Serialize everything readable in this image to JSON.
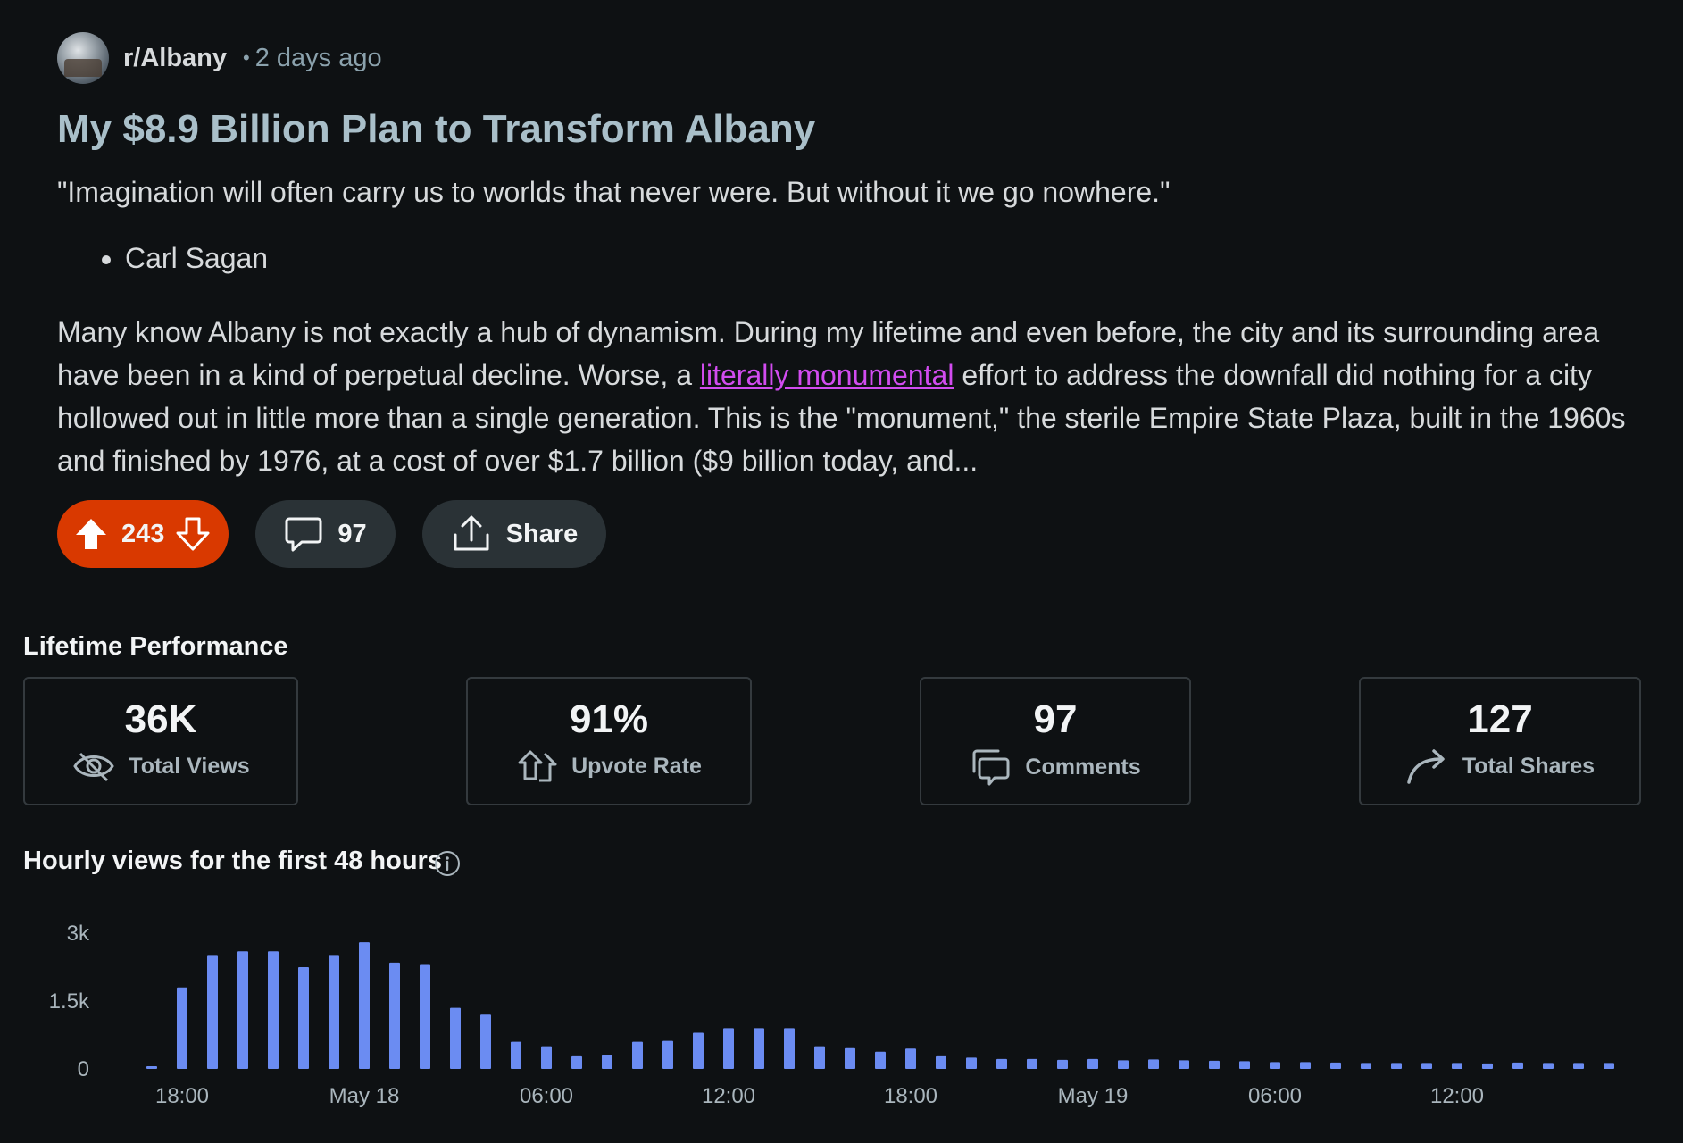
{
  "post": {
    "subreddit": "r/Albany",
    "separator": "•",
    "time": "2 days ago",
    "title": "My $8.9 Billion Plan to Transform Albany",
    "quote": "\"Imagination will often carry us to worlds that never were. But without it we go nowhere.\"",
    "quote_author": "Carl Sagan",
    "body_part1": "Many know Albany is not exactly a hub of dynamism.  During my lifetime and even before, the city and its surrounding area have been in a kind of perpetual decline.  Worse, a ",
    "body_link": "literally monumental",
    "body_part2": " effort to address the downfall did nothing for a city hollowed out in little more than a single generation.  This is the \"monument,\" the sterile Empire State Plaza, built in the 1960s and finished by 1976, at a cost of over $1.7 billion ($9 billion today, and...",
    "votes": "243",
    "comments": "97",
    "share_label": "Share"
  },
  "performance": {
    "heading": "Lifetime Performance",
    "stats": [
      {
        "value": "36K",
        "label": "Total Views",
        "icon": "eye-icon"
      },
      {
        "value": "91%",
        "label": "Upvote Rate",
        "icon": "upvote-icon"
      },
      {
        "value": "97",
        "label": "Comments",
        "icon": "comments-icon"
      },
      {
        "value": "127",
        "label": "Total Shares",
        "icon": "share-arrow-icon"
      }
    ]
  },
  "hourly": {
    "heading": "Hourly views for the first 48 hours"
  },
  "colors": {
    "background": "#0e1113",
    "accent_vote": "#d93900",
    "link": "#d24cf0",
    "bar": "#6b8cf2"
  },
  "chart_data": {
    "type": "bar",
    "title": "Hourly views for the first 48 hours",
    "y_tick_labels": [
      "0",
      "1.5k",
      "3k"
    ],
    "ylim": [
      0,
      3000
    ],
    "x_tick_labels": [
      "18:00",
      "May 18",
      "06:00",
      "12:00",
      "18:00",
      "May 19",
      "06:00",
      "12:00"
    ],
    "x_tick_indices": [
      1,
      7,
      13,
      19,
      25,
      31,
      37,
      43
    ],
    "categories": [
      "17:00",
      "18:00",
      "19:00",
      "20:00",
      "21:00",
      "22:00",
      "23:00",
      "00:00",
      "01:00",
      "02:00",
      "03:00",
      "04:00",
      "05:00",
      "06:00",
      "07:00",
      "08:00",
      "09:00",
      "10:00",
      "11:00",
      "12:00",
      "13:00",
      "14:00",
      "15:00",
      "16:00",
      "17:00",
      "18:00",
      "19:00",
      "20:00",
      "21:00",
      "22:00",
      "23:00",
      "00:00",
      "01:00",
      "02:00",
      "03:00",
      "04:00",
      "05:00",
      "06:00",
      "07:00",
      "08:00",
      "09:00",
      "10:00",
      "11:00",
      "12:00",
      "13:00",
      "14:00",
      "15:00",
      "16:00",
      "17:00"
    ],
    "values": [
      40,
      1800,
      2500,
      2600,
      2600,
      2250,
      2500,
      2800,
      2350,
      2300,
      1350,
      1200,
      600,
      500,
      280,
      300,
      600,
      620,
      800,
      900,
      900,
      900,
      500,
      460,
      380,
      450,
      280,
      250,
      220,
      220,
      200,
      220,
      190,
      210,
      190,
      180,
      170,
      150,
      150,
      140,
      130,
      130,
      130,
      130,
      120,
      140,
      130,
      130,
      130
    ],
    "grid": false,
    "legend": "none"
  }
}
